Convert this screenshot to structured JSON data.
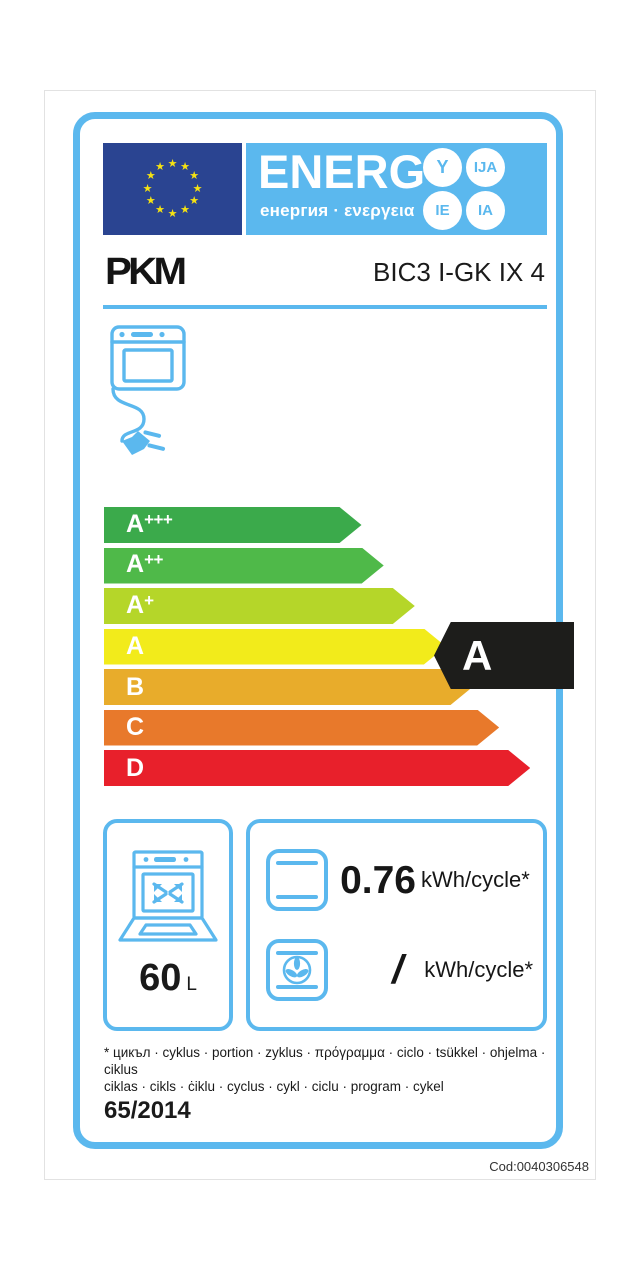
{
  "label": {
    "header": {
      "flag_name": "eu-flag",
      "energ_word": "ENERG",
      "energ_sub": "енергия · ενεργεια",
      "circles": [
        "Y",
        "IJA",
        "IE",
        "IA"
      ]
    },
    "brand": {
      "logo_text": "PKM",
      "model": "BIC3 I-GK IX 4"
    },
    "device_icon_name": "oven-with-plug-icon",
    "scale": {
      "classes": [
        {
          "label": "A",
          "sup": "+++",
          "color": "#3BAA4B",
          "width_pct": 58
        },
        {
          "label": "A",
          "sup": "++",
          "color": "#4FB949",
          "width_pct": 63
        },
        {
          "label": "A",
          "sup": "+",
          "color": "#B5D629",
          "width_pct": 70
        },
        {
          "label": "A",
          "sup": "",
          "color": "#F2EB1B",
          "width_pct": 77
        },
        {
          "label": "B",
          "sup": "",
          "color": "#E8AC2B",
          "width_pct": 83
        },
        {
          "label": "C",
          "sup": "",
          "color": "#E8792B",
          "width_pct": 89
        },
        {
          "label": "D",
          "sup": "",
          "color": "#E8202B",
          "width_pct": 96
        }
      ],
      "rating": "A",
      "rating_bg": "#1d1d1b"
    },
    "volume": {
      "icon_name": "oven-capacity-icon",
      "value": "60",
      "unit": "L"
    },
    "energy": {
      "conventional": {
        "icon_name": "conventional-oven-icon",
        "value": "0.76",
        "unit": "kWh/cycle*"
      },
      "fan_forced": {
        "icon_name": "fan-forced-oven-icon",
        "value": "/",
        "unit": "kWh/cycle*"
      }
    },
    "footnote_line1": "* цикъл · cyklus · portion · zyklus · πρόγραμμα · ciclo · tsükkel · ohjelma · ciklus",
    "footnote_line2": "ciklas · cikls · ċiklu · cyclus · cykl · ciclu · program · cykel",
    "regulation": "65/2014",
    "code": "Cod:0040306548",
    "colors": {
      "frame_blue": "#5bb8ee",
      "flag_blue": "#2a4491",
      "star_yellow": "#f5e212"
    }
  }
}
